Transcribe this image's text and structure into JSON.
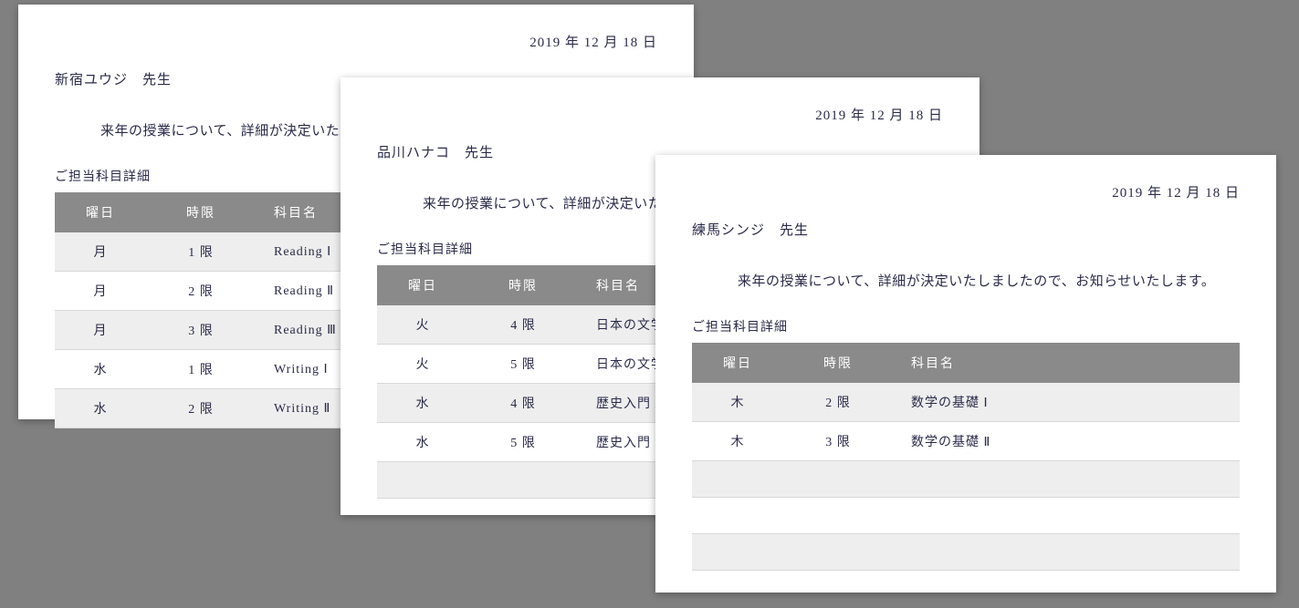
{
  "date": "2019 年 12 月 18 日",
  "body_text": "来年の授業について、詳細が決定いたしましたので、お知らせいたします。",
  "section_title": "ご担当科目詳細",
  "headers": {
    "day": "曜日",
    "period": "時限",
    "subject": "科目名"
  },
  "pages": [
    {
      "recipient": "新宿ユウジ　先生",
      "rows": [
        {
          "day": "月",
          "period": "1 限",
          "subject": "Reading Ⅰ"
        },
        {
          "day": "月",
          "period": "2 限",
          "subject": "Reading Ⅱ"
        },
        {
          "day": "月",
          "period": "3 限",
          "subject": "Reading Ⅲ"
        },
        {
          "day": "水",
          "period": "1 限",
          "subject": "Writing Ⅰ"
        },
        {
          "day": "水",
          "period": "2 限",
          "subject": "Writing Ⅱ"
        }
      ],
      "empty_rows": 0
    },
    {
      "recipient": "品川ハナコ　先生",
      "rows": [
        {
          "day": "火",
          "period": "4 限",
          "subject": "日本の文学 A"
        },
        {
          "day": "火",
          "period": "5 限",
          "subject": "日本の文学 B"
        },
        {
          "day": "水",
          "period": "4 限",
          "subject": "歴史入門 A"
        },
        {
          "day": "水",
          "period": "5 限",
          "subject": "歴史入門 B"
        }
      ],
      "empty_rows": 1
    },
    {
      "recipient": "練馬シンジ　先生",
      "rows": [
        {
          "day": "木",
          "period": "2 限",
          "subject": "数学の基礎 Ⅰ"
        },
        {
          "day": "木",
          "period": "3 限",
          "subject": "数学の基礎 Ⅱ"
        }
      ],
      "empty_rows": 3
    }
  ]
}
